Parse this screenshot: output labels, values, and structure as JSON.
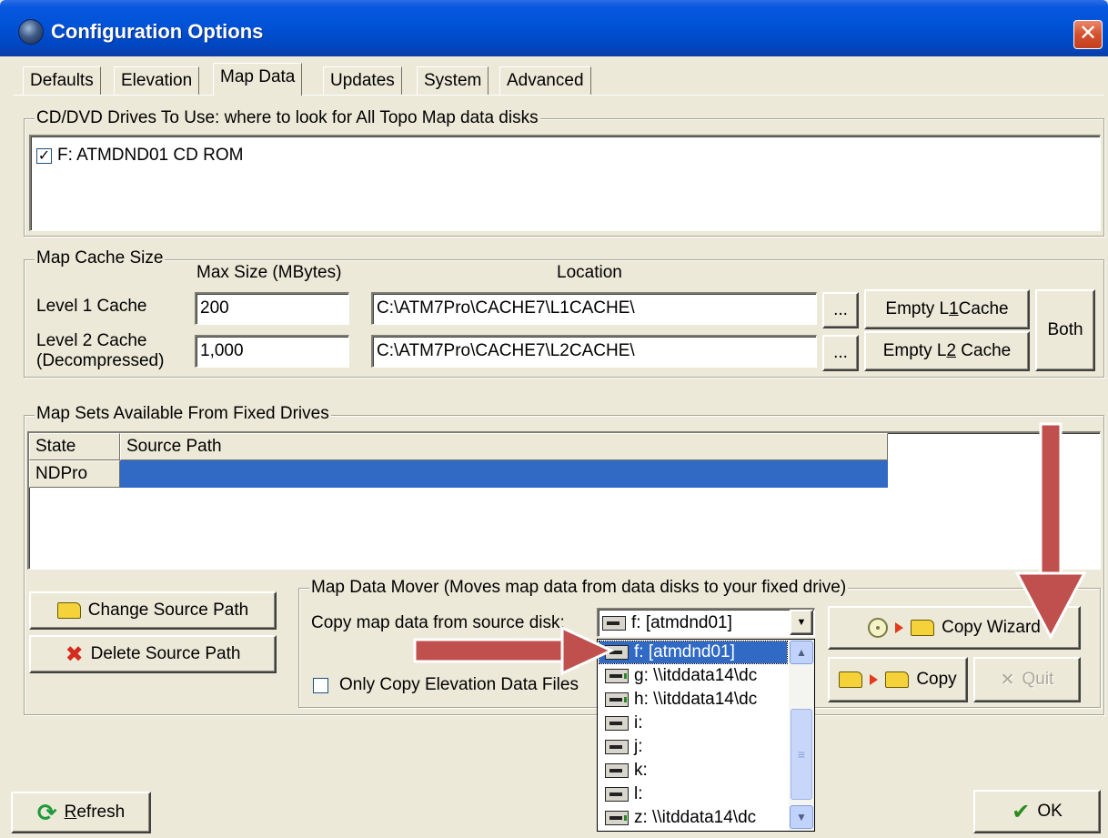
{
  "window": {
    "title": "Configuration Options",
    "close_glyph": "✕"
  },
  "tabs": [
    {
      "label": "Defaults"
    },
    {
      "label": "Elevation"
    },
    {
      "label": "Map Data",
      "active": true
    },
    {
      "label": "Updates"
    },
    {
      "label": "System"
    },
    {
      "label": "Advanced"
    }
  ],
  "cd_drives": {
    "group_title": "CD/DVD Drives To Use:  where to look for All Topo Map data disks",
    "items": [
      {
        "label": "F: ATMDND01 CD ROM",
        "checked": true,
        "check_glyph": "✓"
      }
    ]
  },
  "cache": {
    "group_title": "Map Cache Size",
    "col_max_size": "Max Size (MBytes)",
    "col_location": "Location",
    "level1": {
      "label": "Level 1 Cache",
      "size": "200",
      "path": "C:\\ATM7Pro\\CACHE7\\L1CACHE\\",
      "browse": "...",
      "empty_prefix": "Empty L",
      "empty_ul": "1",
      "empty_suffix": "Cache"
    },
    "level2": {
      "label_line1": "Level 2 Cache",
      "label_line2": "(Decompressed)",
      "size": "1,000",
      "path": "C:\\ATM7Pro\\CACHE7\\L2CACHE\\",
      "browse": "...",
      "empty_prefix": "Empty L",
      "empty_ul": "2",
      "empty_suffix": " Cache"
    },
    "both_label": "Both"
  },
  "map_sets": {
    "group_title": "Map Sets Available From Fixed Drives",
    "columns": [
      "State",
      "Source Path"
    ],
    "rows": [
      {
        "state": "NDPro",
        "source_path": ""
      }
    ]
  },
  "buttons": {
    "change_source": "Change Source Path",
    "delete_source": "Delete Source Path",
    "delete_glyph": "✖",
    "refresh_ul": "R",
    "refresh_rest": "efresh",
    "refresh_glyph": "⟳",
    "ok": "OK",
    "ok_glyph": "✔"
  },
  "mover": {
    "group_title": "Map Data Mover (Moves map data from data disks to your fixed drive)",
    "copy_from_label": "Copy map data from source disk:",
    "selected_disk": "f: [atmdnd01]",
    "dropdown_glyph": "▼",
    "only_elevation_label": "Only Copy Elevation Data Files",
    "copy_wizard": "Copy Wizard",
    "copy": "Copy",
    "quit": "Quit",
    "quit_glyph": "✕"
  },
  "dropdown_list": {
    "items": [
      {
        "label": "f: [atmdnd01]",
        "selected": true,
        "net": false
      },
      {
        "label": "g: \\\\itddata14\\dc",
        "net": true
      },
      {
        "label": "h: \\\\itddata14\\dc",
        "net": true
      },
      {
        "label": "i:",
        "net": false
      },
      {
        "label": "j:",
        "net": false
      },
      {
        "label": "k:",
        "net": false
      },
      {
        "label": "l:",
        "net": false
      },
      {
        "label": "z: \\\\itddata14\\dc",
        "net": true
      }
    ],
    "scroll_up": "▲",
    "scroll_down": "▼",
    "grip": "≡"
  },
  "colors": {
    "selection": "#316ac5",
    "annotation_arrow": "#c0504d"
  }
}
